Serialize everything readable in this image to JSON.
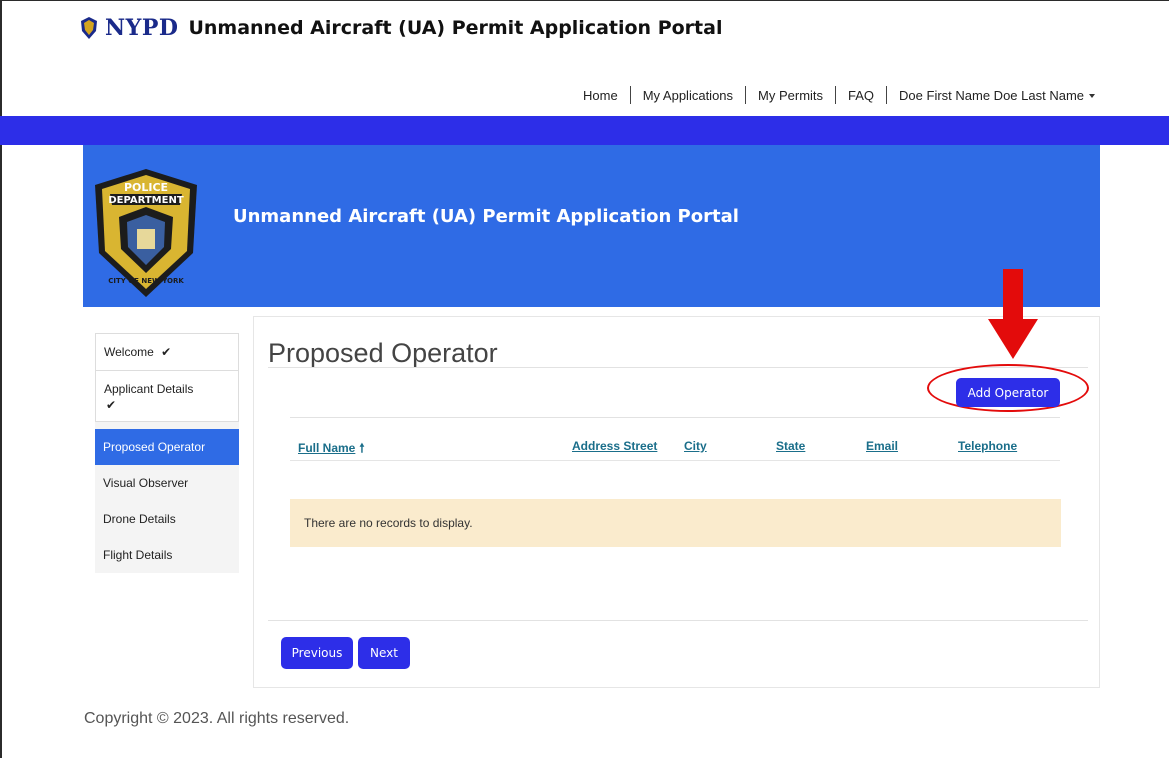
{
  "header": {
    "logo_text": "NYPD",
    "title": "Unmanned Aircraft (UA) Permit Application Portal"
  },
  "nav": {
    "items": [
      "Home",
      "My Applications",
      "My Permits",
      "FAQ"
    ],
    "user": "Doe First Name Doe Last Name"
  },
  "hero": {
    "title": "Unmanned Aircraft (UA) Permit Application Portal",
    "badge_lines": [
      "POLICE",
      "DEPARTMENT",
      "CITY OF NEW YORK"
    ]
  },
  "sidebar": {
    "items": [
      {
        "label": "Welcome",
        "check": "✔"
      },
      {
        "label": "Applicant Details",
        "check": "✔"
      },
      {
        "label": "Proposed Operator"
      },
      {
        "label": "Visual Observer"
      },
      {
        "label": "Drone Details"
      },
      {
        "label": "Flight Details"
      }
    ]
  },
  "main": {
    "title": "Proposed Operator",
    "add_button": "Add Operator",
    "columns": [
      "Full Name",
      "Address Street",
      "City",
      "State",
      "Email",
      "Telephone"
    ],
    "sort_indicator": "🠕",
    "empty_message": "There are no records to display.",
    "previous_button": "Previous",
    "next_button": "Next"
  },
  "footer": {
    "copyright": "Copyright © 2023. All rights reserved."
  },
  "colors": {
    "primary_button": "#2d2ee8",
    "hero_bg": "#2f6be5",
    "highlight": "#e30b0b",
    "empty_row_bg": "#faebcd"
  }
}
